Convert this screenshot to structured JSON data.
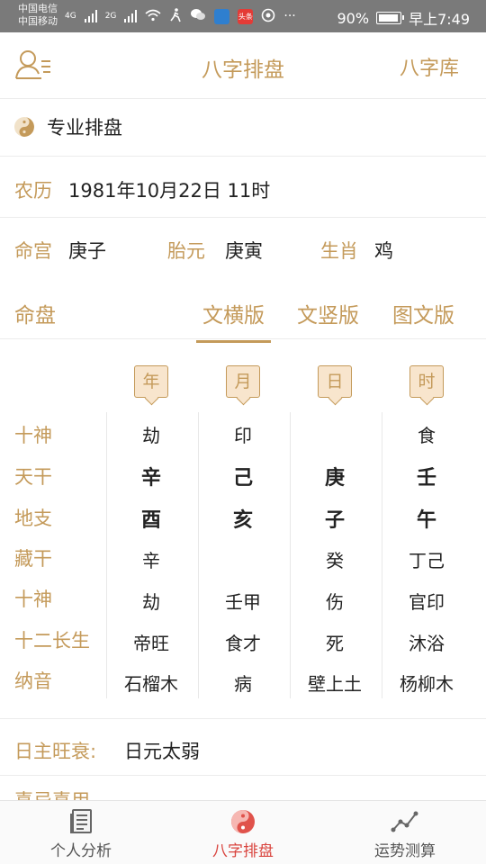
{
  "status_bar": {
    "carrier_1": "中国电信",
    "carrier_2": "中国移动",
    "network_1": "4G",
    "network_2": "2G",
    "app_badge": "头条",
    "more": "···",
    "battery": "90%",
    "time": "早上7:49"
  },
  "header": {
    "title": "八字排盘",
    "right_link": "八字库"
  },
  "mode": {
    "label": "专业排盘"
  },
  "date": {
    "label": "农历",
    "value": "1981年10月22日 11时"
  },
  "info": [
    {
      "label": "命宫",
      "value": "庚子"
    },
    {
      "label": "胎元",
      "value": "庚寅"
    },
    {
      "label": "生肖",
      "value": "鸡"
    }
  ],
  "chart_section": {
    "title": "命盘",
    "tabs": [
      "文横版",
      "文竖版",
      "图文版"
    ],
    "active_tab": "文横版"
  },
  "pillars": {
    "headers": [
      "年",
      "月",
      "日",
      "时"
    ],
    "row_labels": [
      "十神",
      "天干",
      "地支",
      "藏干",
      "十神",
      "十二长生",
      "纳音"
    ],
    "rows": [
      [
        "劫",
        "印",
        "",
        "食"
      ],
      [
        "辛",
        "己",
        "庚",
        "壬"
      ],
      [
        "酉",
        "亥",
        "子",
        "午"
      ],
      [
        "辛",
        "",
        "癸",
        "丁己"
      ],
      [
        "劫",
        "壬甲",
        "伤",
        "官印"
      ],
      [
        "帝旺",
        "食才",
        "死",
        "沐浴"
      ],
      [
        "石榴木",
        "病",
        "壁上土",
        "杨柳木"
      ]
    ]
  },
  "strength": {
    "label": "日主旺衰:",
    "value": "日元太弱"
  },
  "next_section_peek": "喜忌喜用",
  "bottom_nav": [
    {
      "label": "个人分析",
      "icon": "document-icon"
    },
    {
      "label": "八字排盘",
      "icon": "yin-yang-icon"
    },
    {
      "label": "运势测算",
      "icon": "trend-chart-icon"
    }
  ],
  "colors": {
    "accent": "#c49a5a",
    "active_nav": "#d9453f",
    "pill_bg": "#f8e5cd"
  }
}
